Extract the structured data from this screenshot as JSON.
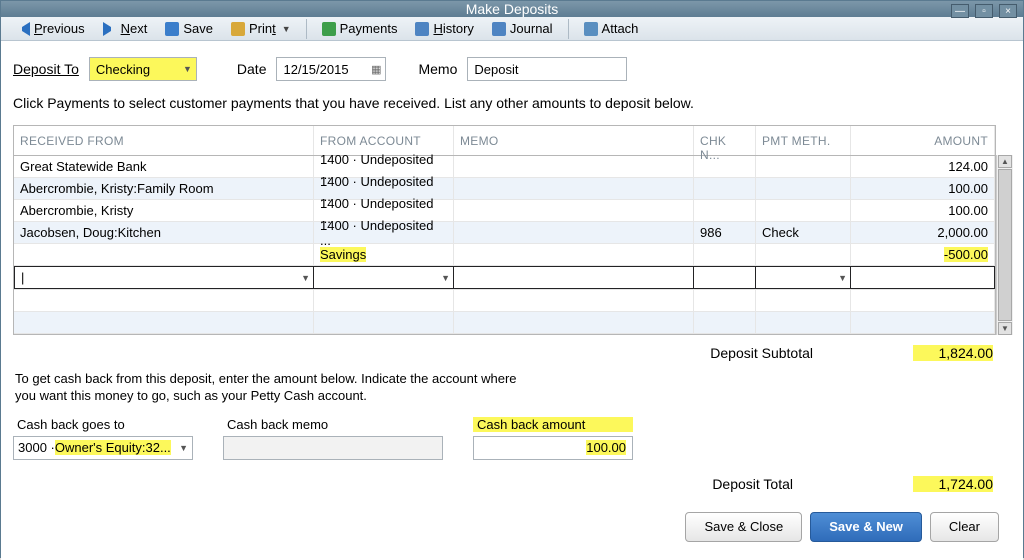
{
  "window": {
    "title": "Make Deposits"
  },
  "toolbar": {
    "previous": "Previous",
    "next": "Next",
    "save": "Save",
    "print": "Print",
    "payments": "Payments",
    "history": "History",
    "journal": "Journal",
    "attach": "Attach"
  },
  "deposit": {
    "to_label": "Deposit To",
    "to_value": "Checking",
    "date_label": "Date",
    "date_value": "12/15/2015",
    "memo_label": "Memo",
    "memo_value": "Deposit"
  },
  "hint": "Click Payments to select customer payments that you have received. List any other amounts to deposit below.",
  "grid": {
    "headers": {
      "from": "Received From",
      "acct": "From Account",
      "memo": "Memo",
      "chk": "Chk N...",
      "pmt": "Pmt Meth.",
      "amt": "Amount"
    },
    "rows": [
      {
        "from": "Great Statewide Bank",
        "acct": "1400 · Undeposited ...",
        "memo": "",
        "chk": "",
        "pmt": "",
        "amt": "124.00"
      },
      {
        "from": "Abercrombie, Kristy:Family Room",
        "acct": "1400 · Undeposited ...",
        "memo": "",
        "chk": "",
        "pmt": "",
        "amt": "100.00"
      },
      {
        "from": "Abercrombie, Kristy",
        "acct": "1400 · Undeposited ...",
        "memo": "",
        "chk": "",
        "pmt": "",
        "amt": "100.00"
      },
      {
        "from": "Jacobsen, Doug:Kitchen",
        "acct": "1400 · Undeposited ...",
        "memo": "",
        "chk": "986",
        "pmt": "Check",
        "amt": "2,000.00"
      },
      {
        "from": "",
        "acct": "Savings",
        "memo": "",
        "chk": "",
        "pmt": "",
        "amt": "-500.00",
        "hl_acct": true,
        "hl_amt": true
      }
    ]
  },
  "subtotal": {
    "label": "Deposit Subtotal",
    "value": "1,824.00"
  },
  "cashback": {
    "hint1": "To get cash back from this deposit, enter the amount below.  Indicate the account where",
    "hint2": "you want this money to go, such as your Petty Cash account.",
    "goes_to_label": "Cash back goes to",
    "goes_to_prefix": "3000 · ",
    "goes_to_value": "Owner's Equity:32...",
    "memo_label": "Cash back memo",
    "memo_value": "",
    "amount_label": "Cash back amount",
    "amount_value": "100.00"
  },
  "total": {
    "label": "Deposit Total",
    "value": "1,724.00"
  },
  "actions": {
    "save_close": "Save & Close",
    "save_new": "Save & New",
    "clear": "Clear"
  }
}
